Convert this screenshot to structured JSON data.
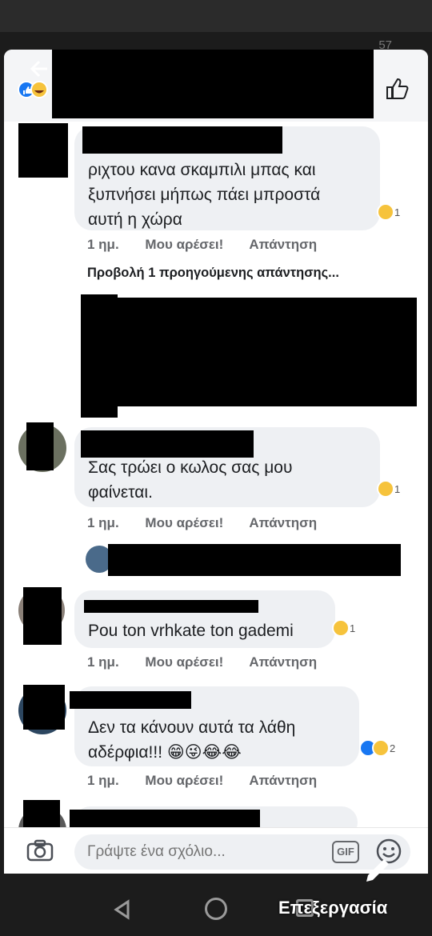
{
  "status": {
    "time": "57"
  },
  "header": {
    "back_icon": "arrow-left-icon",
    "like_icon": "thumbs-up-icon"
  },
  "comments": [
    {
      "lines": [
        "ριχτου κανα σκαμπιλι μπας και",
        "ξυπνήσει μήπως πάει μπροστά",
        "αυτή η χώρα"
      ],
      "time": "1 ημ.",
      "like": "Μου αρέσει!",
      "reply": "Απάντηση",
      "reactions": "1"
    },
    {
      "lines": [
        "Σας τρώει ο κωλος σας μου",
        "φαίνεται."
      ],
      "time": "1 ημ.",
      "like": "Μου αρέσει!",
      "reply": "Απάντηση",
      "reactions": "1"
    },
    {
      "lines": [
        "Pou ton vrhkate ton gademi"
      ],
      "time": "1 ημ.",
      "like": "Μου αρέσει!",
      "reply": "Απάντηση",
      "reactions": "1"
    },
    {
      "lines": [
        "Δεν τα κάνουν αυτά τα λάθη",
        "αδέρφια!!! 😁😜😂😂"
      ],
      "time": "1 ημ.",
      "like": "Μου αρέσει!",
      "reply": "Απάντηση",
      "reactions": "2"
    }
  ],
  "previous_replies": "Προβολή 1 προηγούμενης απάντησης...",
  "composer": {
    "placeholder": "Γράψτε ένα σχόλιο...",
    "gif": "GIF"
  },
  "watermark": "Επεξεργασία",
  "colors": {
    "link": "#1877f2",
    "haha": "#f6c33c",
    "meta": "#65676b"
  }
}
